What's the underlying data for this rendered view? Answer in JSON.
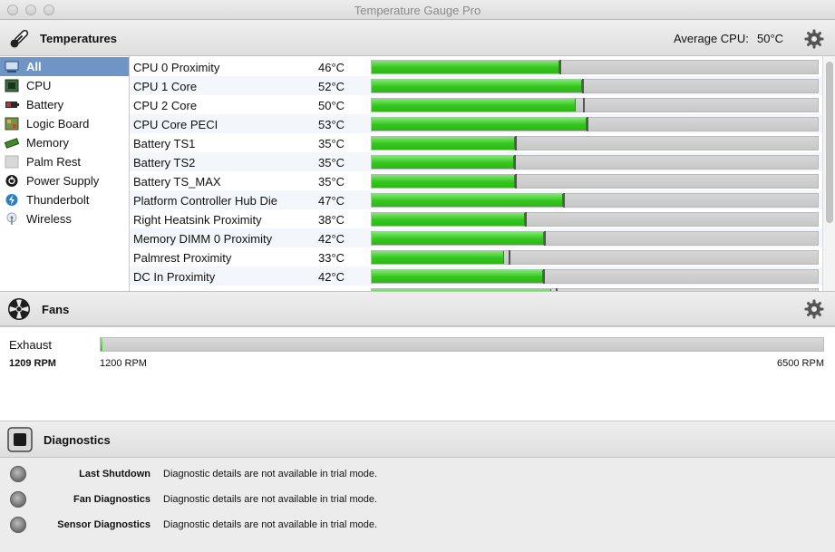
{
  "window": {
    "title": "Temperature Gauge Pro"
  },
  "temperatures": {
    "title": "Temperatures",
    "average_label": "Average CPU:",
    "average_value": "50°C"
  },
  "sidebar": {
    "items": [
      {
        "label": "All",
        "icon": "all-icon"
      },
      {
        "label": "CPU",
        "icon": "cpu-icon"
      },
      {
        "label": "Battery",
        "icon": "battery-icon"
      },
      {
        "label": "Logic Board",
        "icon": "logic-board-icon"
      },
      {
        "label": "Memory",
        "icon": "memory-icon"
      },
      {
        "label": "Palm Rest",
        "icon": "palm-rest-icon"
      },
      {
        "label": "Power Supply",
        "icon": "power-supply-icon"
      },
      {
        "label": "Thunderbolt",
        "icon": "thunderbolt-icon"
      },
      {
        "label": "Wireless",
        "icon": "wireless-icon"
      }
    ]
  },
  "sensors": [
    {
      "name": "CPU 0 Proximity",
      "value": "46°C",
      "fill": 0.42,
      "peak": 0.42
    },
    {
      "name": "CPU 1 Core",
      "value": "52°C",
      "fill": 0.47,
      "peak": 0.47
    },
    {
      "name": "CPU 2 Core",
      "value": "50°C",
      "fill": 0.455,
      "peak": 0.472
    },
    {
      "name": "CPU Core PECI",
      "value": "53°C",
      "fill": 0.48,
      "peak": 0.48
    },
    {
      "name": "Battery TS1",
      "value": "35°C",
      "fill": 0.32,
      "peak": 0.32
    },
    {
      "name": "Battery TS2",
      "value": "35°C",
      "fill": 0.318,
      "peak": 0.318
    },
    {
      "name": "Battery TS_MAX",
      "value": "35°C",
      "fill": 0.32,
      "peak": 0.32
    },
    {
      "name": "Platform Controller Hub Die",
      "value": "47°C",
      "fill": 0.428,
      "peak": 0.428
    },
    {
      "name": "Right Heatsink Proximity",
      "value": "38°C",
      "fill": 0.343,
      "peak": 0.343
    },
    {
      "name": "Memory DIMM 0 Proximity",
      "value": "42°C",
      "fill": 0.385,
      "peak": 0.385
    },
    {
      "name": "Palmrest Proximity",
      "value": "33°C",
      "fill": 0.295,
      "peak": 0.305
    },
    {
      "name": "DC In Proximity",
      "value": "42°C",
      "fill": 0.382,
      "peak": 0.382
    },
    {
      "name": "",
      "value": "",
      "fill": 0.4,
      "peak": 0.41
    }
  ],
  "fans": {
    "title": "Fans",
    "items": [
      {
        "name": "Exhaust",
        "rpm": "1209 RPM",
        "min": "1200 RPM",
        "max": "6500 RPM",
        "fill": 0.002
      }
    ]
  },
  "diagnostics": {
    "title": "Diagnostics",
    "items": [
      {
        "label": "Last Shutdown",
        "text": "Diagnostic details are not available in trial mode."
      },
      {
        "label": "Fan Diagnostics",
        "text": "Diagnostic details are not available in trial mode."
      },
      {
        "label": "Sensor Diagnostics",
        "text": "Diagnostic details are not available in trial mode."
      }
    ]
  },
  "colors": {
    "accent_selection": "#6f95c6",
    "bar_green": "#35c51d"
  }
}
